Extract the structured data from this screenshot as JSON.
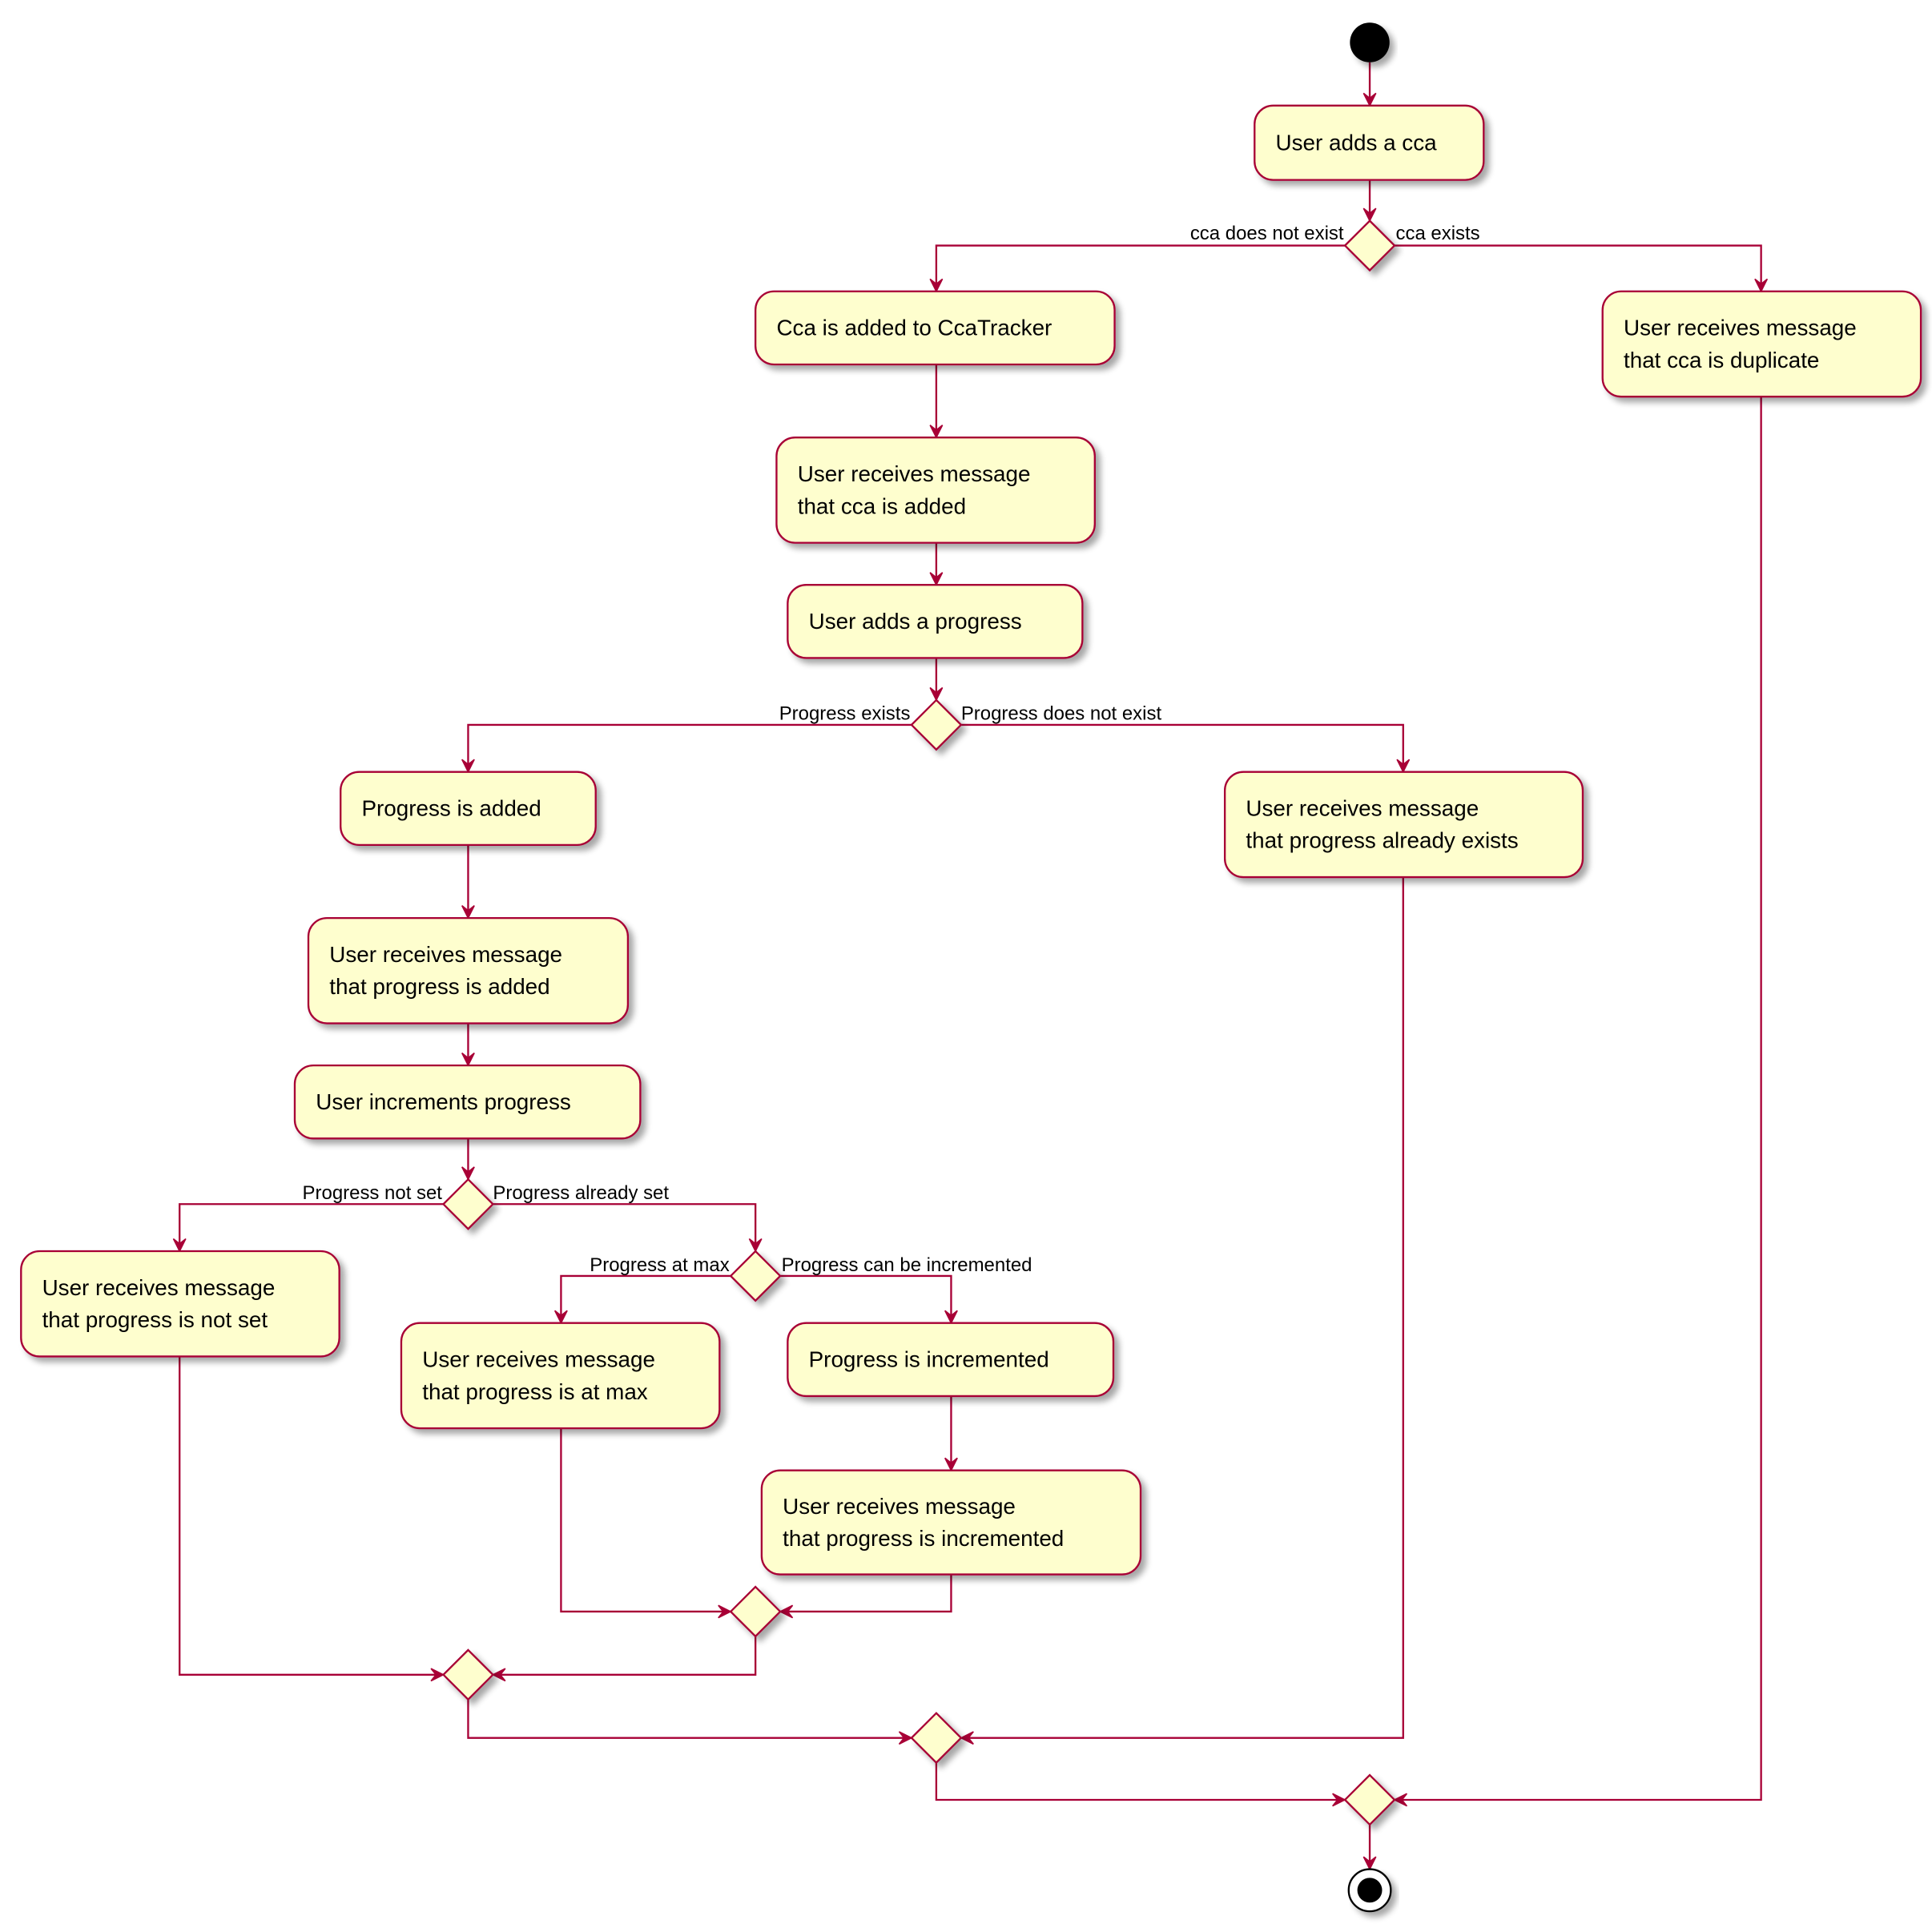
{
  "colors": {
    "node_fill": "#FEFECE",
    "node_border": "#A80036",
    "edge": "#A80036",
    "start_end": "#000000"
  },
  "nodes": {
    "add_cca": [
      "User adds a cca"
    ],
    "cca_added_tracker": [
      "Cca is added to CcaTracker"
    ],
    "cca_duplicate_msg": [
      "User receives message",
      "that cca is duplicate"
    ],
    "cca_added_msg": [
      "User receives message",
      "that cca is added"
    ],
    "add_progress": [
      "User adds a progress"
    ],
    "progress_added": [
      "Progress is added"
    ],
    "progress_exists_msg": [
      "User receives message",
      "that progress already exists"
    ],
    "progress_added_msg": [
      "User receives message",
      "that progress is added"
    ],
    "increment_progress": [
      "User increments progress"
    ],
    "progress_not_set_msg": [
      "User receives message",
      "that progress is not set"
    ],
    "progress_at_max_msg": [
      "User receives message",
      "that progress is at max"
    ],
    "progress_incremented": [
      "Progress is incremented"
    ],
    "progress_incremented_msg": [
      "User receives message",
      " that progress is incremented"
    ]
  },
  "branch_labels": {
    "cca_not_exist": "cca does not exist",
    "cca_exists": "cca exists",
    "progress_exists": "Progress exists",
    "progress_not_exist": "Progress does not exist",
    "progress_not_set": "Progress not set",
    "progress_already_set": "Progress already set",
    "progress_at_max": "Progress at max",
    "progress_can_increment": "Progress can be incremented"
  }
}
